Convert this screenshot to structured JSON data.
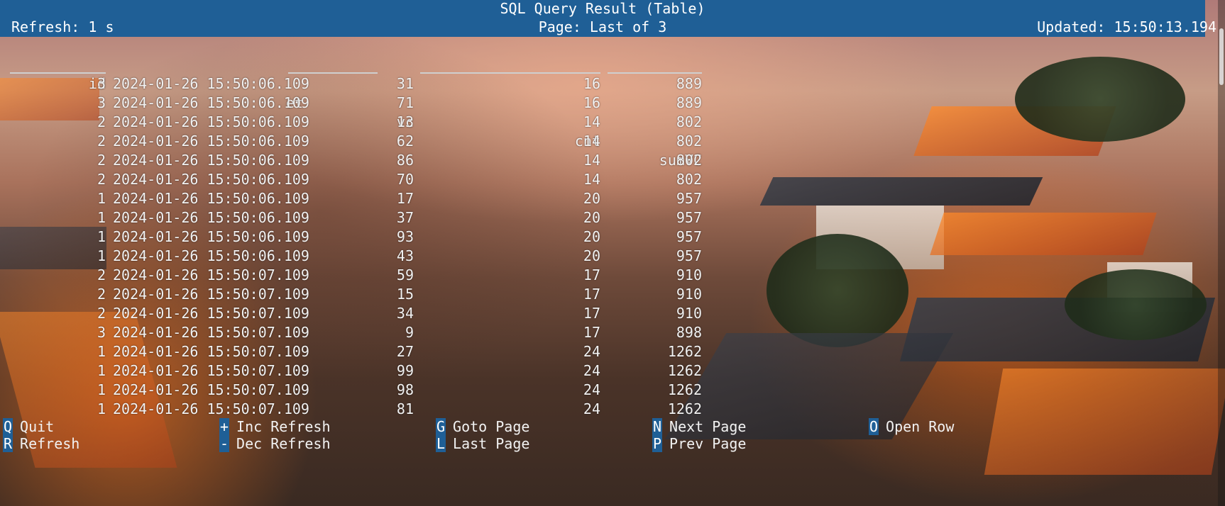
{
  "header": {
    "title": "SQL Query Result (Table)",
    "refresh": "Refresh: 1 s",
    "page": "Page: Last of 3",
    "updated": "Updated: 15:50:13.194"
  },
  "table": {
    "columns": [
      "id",
      "et",
      "vc",
      "cnt",
      "sumVC"
    ],
    "rows": [
      [
        "3",
        "2024-01-26 15:50:06.109",
        "31",
        "16",
        "889"
      ],
      [
        "3",
        "2024-01-26 15:50:06.109",
        "71",
        "16",
        "889"
      ],
      [
        "2",
        "2024-01-26 15:50:06.109",
        "13",
        "14",
        "802"
      ],
      [
        "2",
        "2024-01-26 15:50:06.109",
        "62",
        "14",
        "802"
      ],
      [
        "2",
        "2024-01-26 15:50:06.109",
        "86",
        "14",
        "802"
      ],
      [
        "2",
        "2024-01-26 15:50:06.109",
        "70",
        "14",
        "802"
      ],
      [
        "1",
        "2024-01-26 15:50:06.109",
        "17",
        "20",
        "957"
      ],
      [
        "1",
        "2024-01-26 15:50:06.109",
        "37",
        "20",
        "957"
      ],
      [
        "1",
        "2024-01-26 15:50:06.109",
        "93",
        "20",
        "957"
      ],
      [
        "1",
        "2024-01-26 15:50:06.109",
        "43",
        "20",
        "957"
      ],
      [
        "2",
        "2024-01-26 15:50:07.109",
        "59",
        "17",
        "910"
      ],
      [
        "2",
        "2024-01-26 15:50:07.109",
        "15",
        "17",
        "910"
      ],
      [
        "2",
        "2024-01-26 15:50:07.109",
        "34",
        "17",
        "910"
      ],
      [
        "3",
        "2024-01-26 15:50:07.109",
        "9",
        "17",
        "898"
      ],
      [
        "1",
        "2024-01-26 15:50:07.109",
        "27",
        "24",
        "1262"
      ],
      [
        "1",
        "2024-01-26 15:50:07.109",
        "99",
        "24",
        "1262"
      ],
      [
        "1",
        "2024-01-26 15:50:07.109",
        "98",
        "24",
        "1262"
      ],
      [
        "1",
        "2024-01-26 15:50:07.109",
        "81",
        "24",
        "1262"
      ]
    ]
  },
  "footer": {
    "shortcuts": [
      {
        "key": "Q",
        "label": "Quit"
      },
      {
        "key": "R",
        "label": "Refresh"
      },
      {
        "key": "+",
        "label": "Inc Refresh"
      },
      {
        "key": "-",
        "label": "Dec Refresh"
      },
      {
        "key": "G",
        "label": "Goto Page"
      },
      {
        "key": "L",
        "label": "Last Page"
      },
      {
        "key": "N",
        "label": "Next Page"
      },
      {
        "key": "P",
        "label": "Prev Page"
      },
      {
        "key": "O",
        "label": "Open Row"
      }
    ]
  },
  "colors": {
    "bar": "#1f5f96",
    "text": "#f2f2f2"
  }
}
